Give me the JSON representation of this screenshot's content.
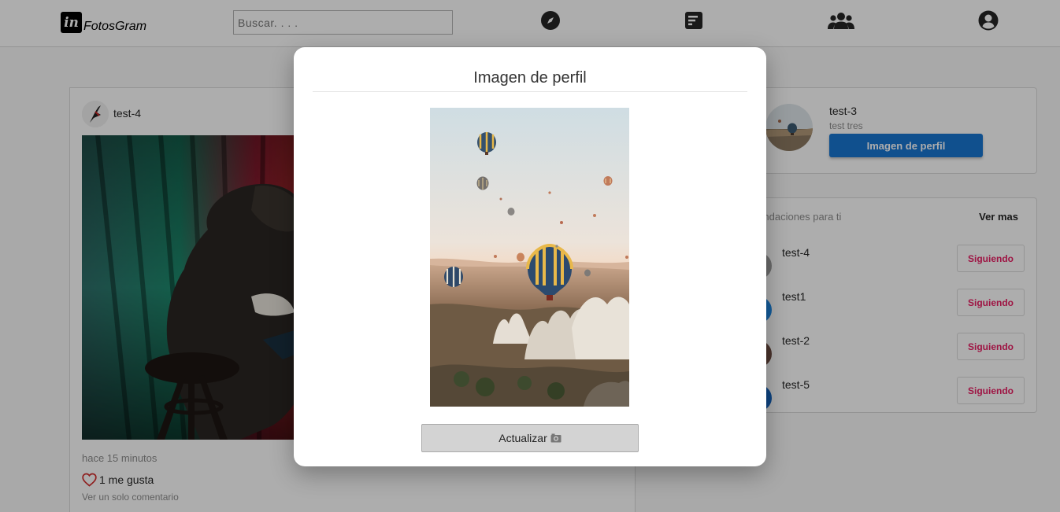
{
  "header": {
    "logo_mark": "in",
    "brand": "FotosGram",
    "search_placeholder": "Buscar. . . .",
    "nav_icons": [
      "compass-icon",
      "feed-icon",
      "group-icon",
      "account-icon"
    ]
  },
  "post": {
    "username": "test-4",
    "time": "hace 15 minutos",
    "likes": "1 me gusta",
    "comments": "Ver un solo comentario"
  },
  "profile": {
    "username": "test-3",
    "fullname": "test tres",
    "button_label": "Imagen de perfil"
  },
  "suggestions": {
    "title": "Recomendaciones para ti",
    "more": "Ver mas",
    "items": [
      {
        "name": "test-4",
        "button": "Siguiendo",
        "avatar_color": "#9e9e9e"
      },
      {
        "name": "test1",
        "button": "Siguiendo",
        "avatar_color": "#1e88e5"
      },
      {
        "name": "test-2",
        "button": "Siguiendo",
        "avatar_color": "#6d4c41"
      },
      {
        "name": "test-5",
        "button": "Siguiendo",
        "avatar_color": "#1565c0"
      }
    ]
  },
  "modal": {
    "title": "Imagen de perfil",
    "update_label": "Actualizar"
  },
  "colors": {
    "primary_button": "#1976d2",
    "following_text": "#e91e63",
    "like_heart": "#d32f2f"
  }
}
